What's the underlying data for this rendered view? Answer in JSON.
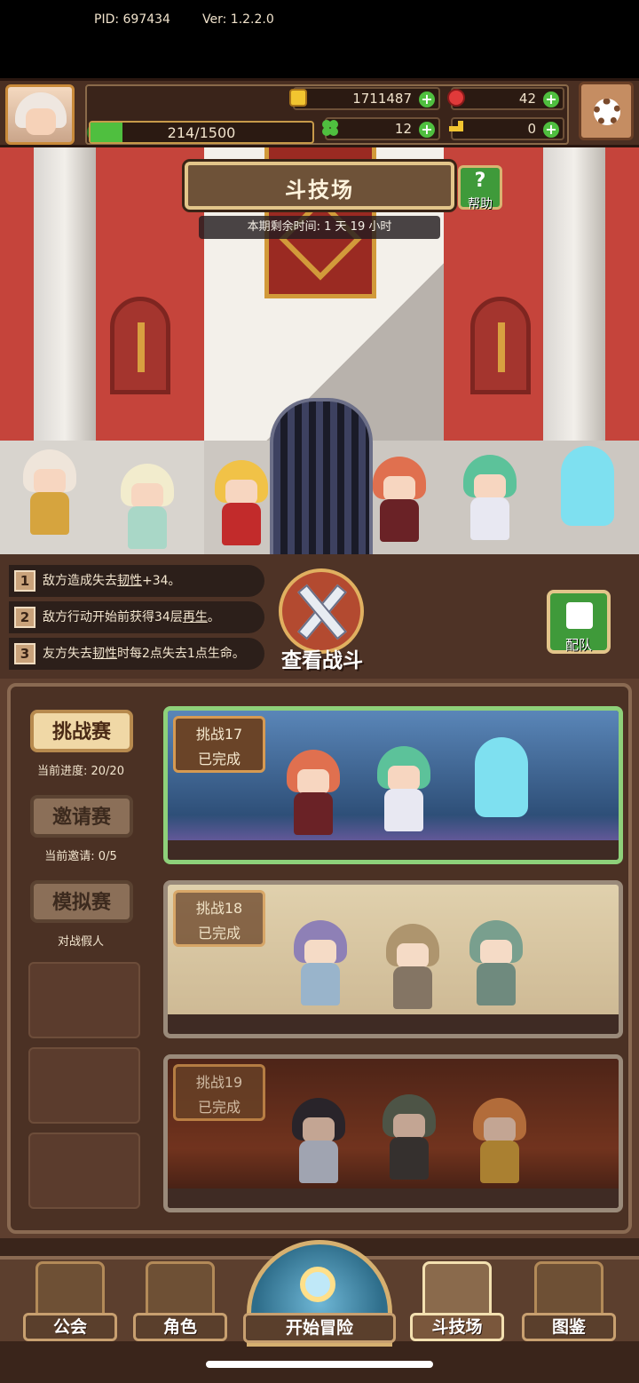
{
  "hud": {
    "pid": "PID: 697434",
    "version": "Ver: 1.2.2.0",
    "gold": "1711487",
    "gems": "42",
    "clover": "12",
    "keys": "0",
    "energy": "214/1500",
    "energy_fraction": 0.143
  },
  "arena": {
    "title": "斗技场",
    "help_label": "帮助",
    "time_remaining": "本期剩余时间: 1 天 19 小时"
  },
  "effects": [
    {
      "num": "1",
      "text_before": "敌方造成失去",
      "keyword": "韧性",
      "text_after": "+34。"
    },
    {
      "num": "2",
      "text_before": "敌方行动开始前获得34层",
      "keyword": "再生",
      "text_after": "。"
    },
    {
      "num": "3",
      "text_before": "友方失去",
      "keyword": "韧性",
      "text_after": "时每2点失去1点生命。"
    }
  ],
  "watch_battle_label": "查看战斗",
  "team_label": "配队",
  "modes": [
    {
      "label": "挑战赛",
      "sub": "当前进度: 20/20",
      "active": true
    },
    {
      "label": "邀请赛",
      "sub": "当前邀请: 0/5",
      "active": false
    },
    {
      "label": "模拟赛",
      "sub": "对战假人",
      "active": false
    }
  ],
  "challenges": [
    {
      "name": "挑战17",
      "status": "已完成",
      "bg": "#5a86b8",
      "highlight": true
    },
    {
      "name": "挑战18",
      "status": "已完成",
      "bg": "#c9b48a",
      "highlight": false
    },
    {
      "name": "挑战19",
      "status": "已完成",
      "bg": "#7a3a24",
      "highlight": false
    }
  ],
  "nav": {
    "guild": "公会",
    "characters": "角色",
    "adventure": "开始冒险",
    "arena": "斗技场",
    "codex": "图鉴"
  },
  "colors": {
    "accent_green": "#4fbf3f",
    "wall_red": "#c5443b",
    "panel_brown": "#4b3124"
  }
}
